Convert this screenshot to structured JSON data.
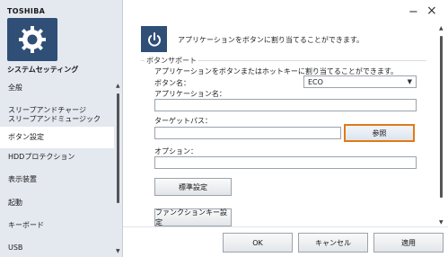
{
  "brand": "TOSHIBA",
  "app_title": "システムセッティング",
  "nav": {
    "items": [
      {
        "label": "全般"
      },
      {
        "label": "スリープアンドチャージ\nスリープアンドミュージック"
      },
      {
        "label": "ボタン設定"
      },
      {
        "label": "HDDプロテクション"
      },
      {
        "label": "表示装置"
      },
      {
        "label": "起動"
      },
      {
        "label": "キーボード"
      },
      {
        "label": "USB"
      }
    ],
    "active_index": 2
  },
  "window": {
    "minimize": "−",
    "close": "×"
  },
  "header": {
    "description": "アプリケーションをボタンに割り当てることができます。",
    "icon": "power-icon"
  },
  "group": {
    "title": "ボタンサポート",
    "description": "アプリケーションをボタンまたはホットキーに割り当てることができます。",
    "button_name_label": "ボタン名：",
    "button_name_value": "ECO",
    "app_name_label": "アプリケーション名：",
    "app_name_value": "",
    "target_path_label": "ターゲットパス：",
    "target_path_value": "",
    "browse_label": "参照",
    "option_label": "オプション：",
    "option_value": "",
    "standard_label": "標準設定",
    "fnkey_label": "ファンクションキー設定"
  },
  "footer": {
    "ok": "OK",
    "cancel": "キャンセル",
    "apply": "適用"
  },
  "colors": {
    "accent": "#2f4f77",
    "highlight": "#e07a1a"
  }
}
